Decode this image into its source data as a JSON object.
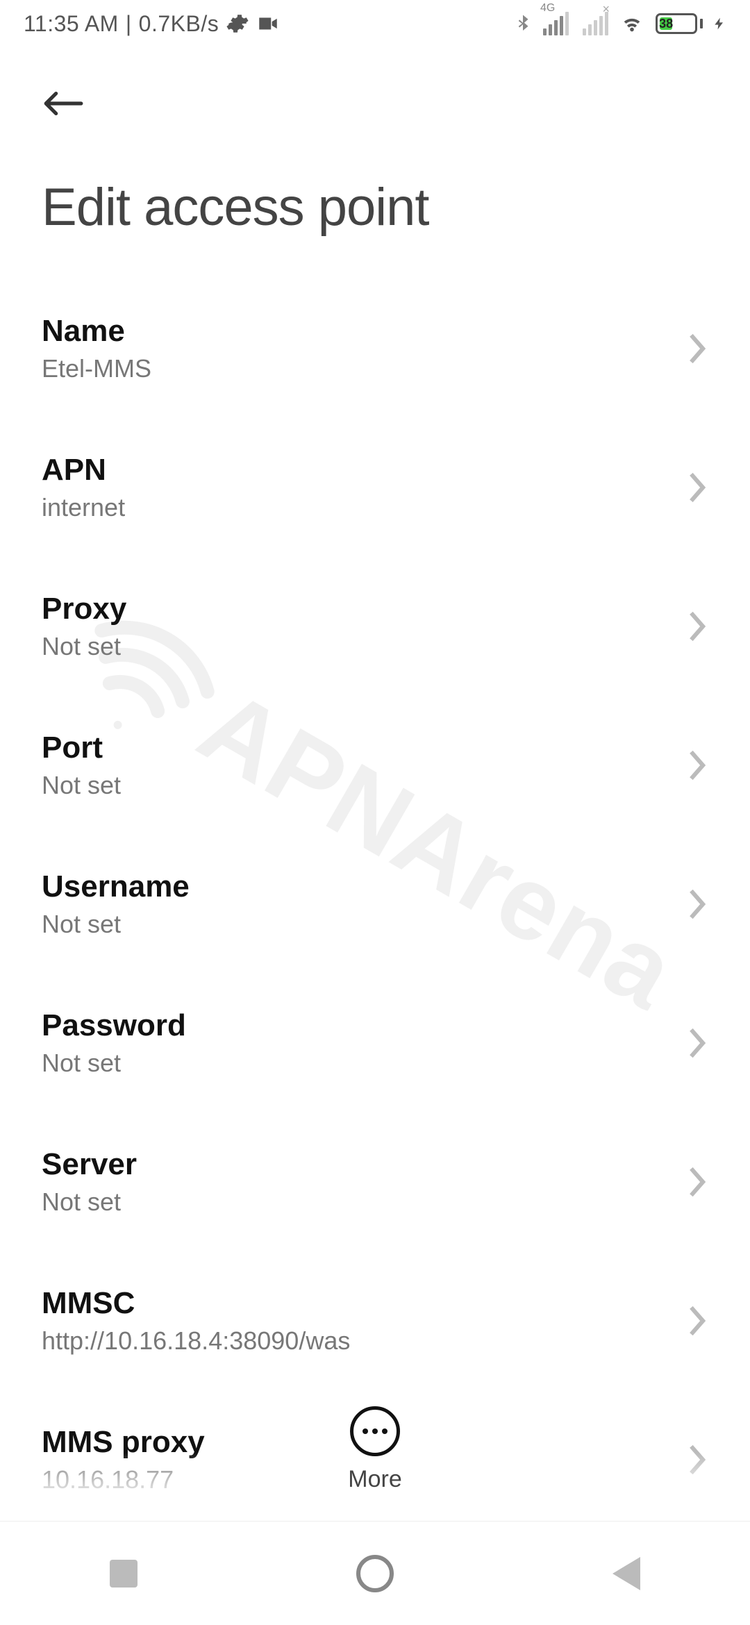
{
  "status_bar": {
    "time": "11:35 AM",
    "net_speed": "0.7KB/s",
    "signal_label_4g": "4G",
    "battery_percent": "38",
    "battery_width_pct": 38
  },
  "header": {
    "title": "Edit access point"
  },
  "settings": [
    {
      "label": "Name",
      "value": "Etel-MMS"
    },
    {
      "label": "APN",
      "value": "internet"
    },
    {
      "label": "Proxy",
      "value": "Not set"
    },
    {
      "label": "Port",
      "value": "Not set"
    },
    {
      "label": "Username",
      "value": "Not set"
    },
    {
      "label": "Password",
      "value": "Not set"
    },
    {
      "label": "Server",
      "value": "Not set"
    },
    {
      "label": "MMSC",
      "value": "http://10.16.18.4:38090/was"
    },
    {
      "label": "MMS proxy",
      "value": "10.16.18.77"
    }
  ],
  "more_label": "More",
  "watermark_text": "APNArena"
}
